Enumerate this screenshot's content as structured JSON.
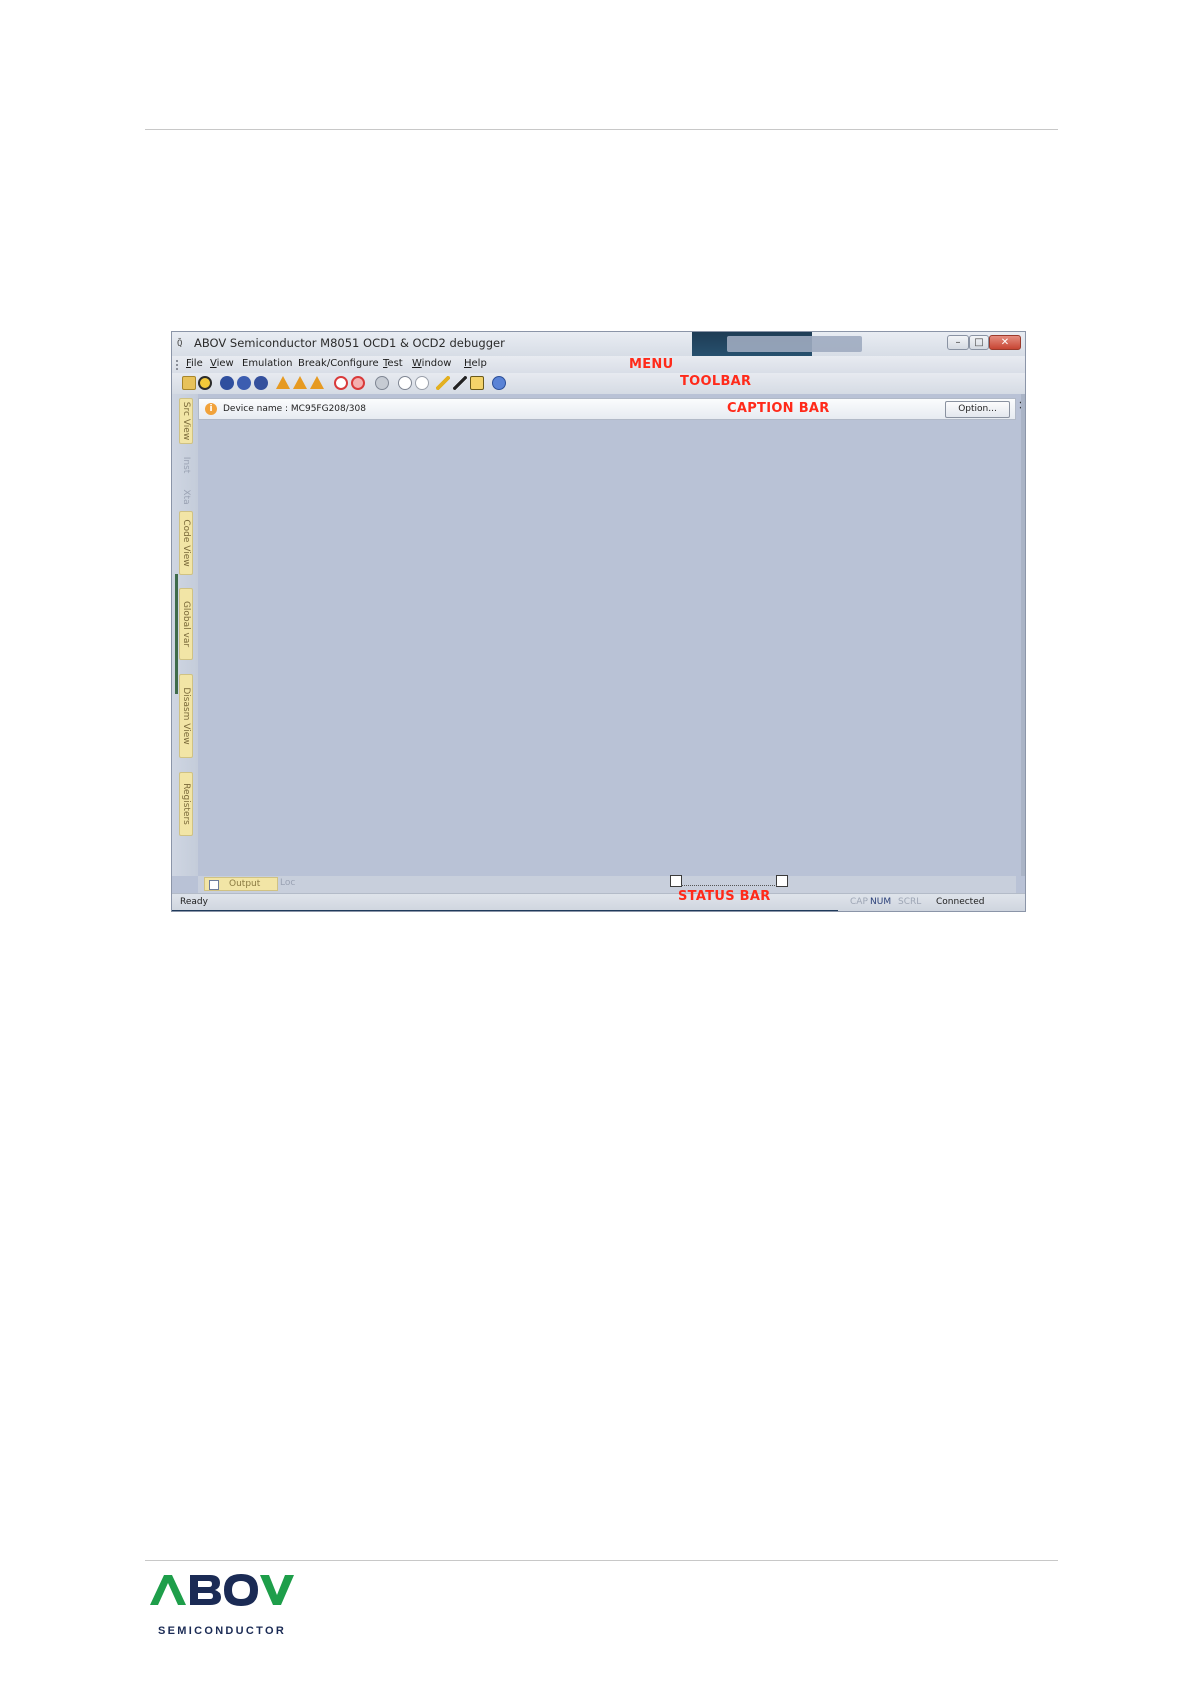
{
  "app": {
    "title": "ABOV Semiconductor M8051 OCD1 & OCD2 debugger",
    "icon": "Q̄",
    "menu": [
      {
        "key": "file",
        "letter": "F",
        "rest": "ile"
      },
      {
        "key": "view",
        "letter": "V",
        "rest": "iew"
      },
      {
        "key": "emulation",
        "letter": "",
        "rest": "Emulation"
      },
      {
        "key": "break",
        "letter": "",
        "rest": "Break/Configure"
      },
      {
        "key": "test",
        "letter": "T",
        "rest": "est"
      },
      {
        "key": "window",
        "letter": "W",
        "rest": "indow"
      },
      {
        "key": "help",
        "letter": "H",
        "rest": "elp"
      }
    ],
    "caption": {
      "info_icon": "i",
      "device_label": "Device name : MC95FG208/308",
      "option_button": "Option...",
      "close": "×"
    },
    "side_tabs": [
      "Src View",
      "Inst",
      "Xta",
      "Code View",
      "Global var",
      "Disasm View",
      "Registers"
    ],
    "bottom_tabs": {
      "output": "Output",
      "loc": "Loc"
    },
    "status": {
      "ready": "Ready",
      "cap": "CAP",
      "num": "NUM",
      "scrl": "SCRL",
      "connection": "Connected"
    },
    "title_buttons": {
      "min": "–",
      "max": "□",
      "close": "✕"
    }
  },
  "annotations": {
    "menu": "MENU",
    "toolbar": "TOOLBAR",
    "caption_bar": "CAPTION BAR",
    "status_bar": "STATUS BAR"
  },
  "footer": {
    "logo_text": "ABOV",
    "logo_sub": "SEMICONDUCTOR"
  },
  "colors": {
    "annotation": "#ff2a1a",
    "logo_green": "#1e9e4a",
    "logo_navy": "#1b2b55",
    "workspace": "#b9c2d6"
  }
}
